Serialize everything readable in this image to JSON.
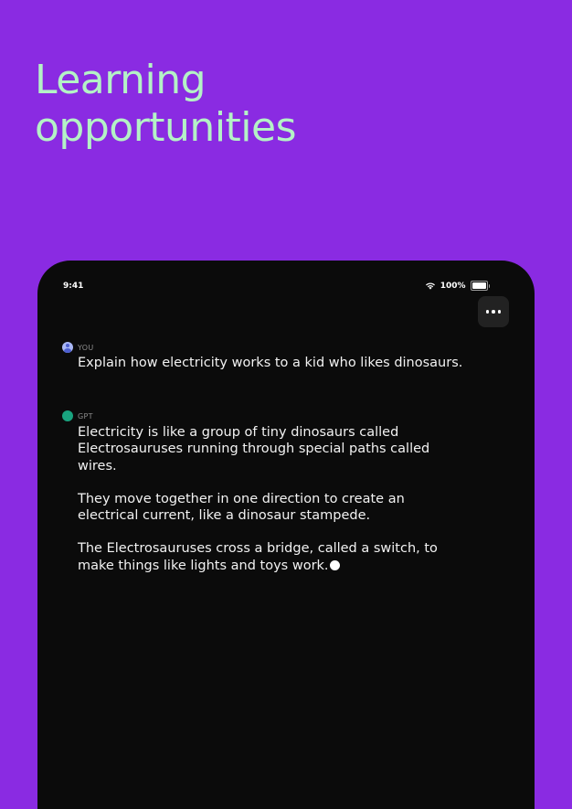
{
  "headline": {
    "line1": "Learning",
    "line2": "opportunities"
  },
  "colors": {
    "background": "#8a2be2",
    "headline": "#b4f2c6",
    "device": "#0b0b0b",
    "gpt_avatar": "#19a37f"
  },
  "status_bar": {
    "time": "9:41",
    "battery": "100%",
    "battery_level": 1.0,
    "wifi_icon": "wifi-icon"
  },
  "toolbar": {
    "more_icon": "ellipsis-icon"
  },
  "conversation": {
    "user_message": {
      "author": "YOU",
      "text": "Explain how electricity works to a kid who likes dinosaurs."
    },
    "assistant_message": {
      "author": "GPT",
      "paragraphs": [
        "Electricity is like a group of tiny dinosaurs called Electrosauruses running through special paths called wires.",
        "They move together in one direction to create an electrical current, like a dinosaur stampede.",
        "The Electrosauruses cross a bridge, called a switch, to make things like lights and toys work."
      ]
    }
  }
}
